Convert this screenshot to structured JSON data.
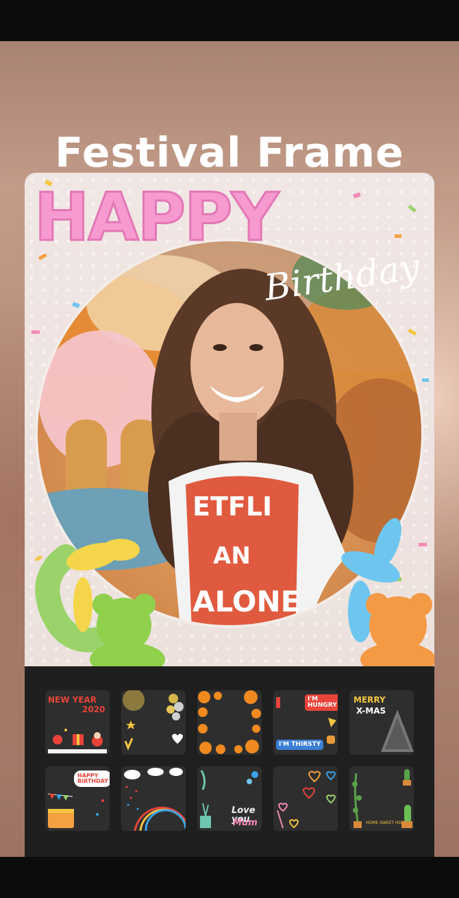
{
  "page": {
    "title": "Festival Frame"
  },
  "preview": {
    "headline": "HAPPY",
    "script_text": "Birthday",
    "shirt_text_line1": "ETFLI",
    "shirt_text_line2": "AN",
    "shirt_text_line3": "ALONE"
  },
  "frames": [
    {
      "label_line1": "NEW YEAR",
      "label_line2": "2020"
    },
    {},
    {},
    {
      "label_line1": "I'M HUNGRY",
      "label_line2": "I'M THIRSTY"
    },
    {
      "label_line1": "MERRY",
      "label_line2": "X-MAS"
    },
    {
      "label_line1": "HAPPY BIRTHDAY"
    },
    {},
    {
      "label_line1": "Love you",
      "label_line2": "Mum"
    },
    {},
    {
      "label_line1": "HOME SWEET HOME"
    }
  ]
}
